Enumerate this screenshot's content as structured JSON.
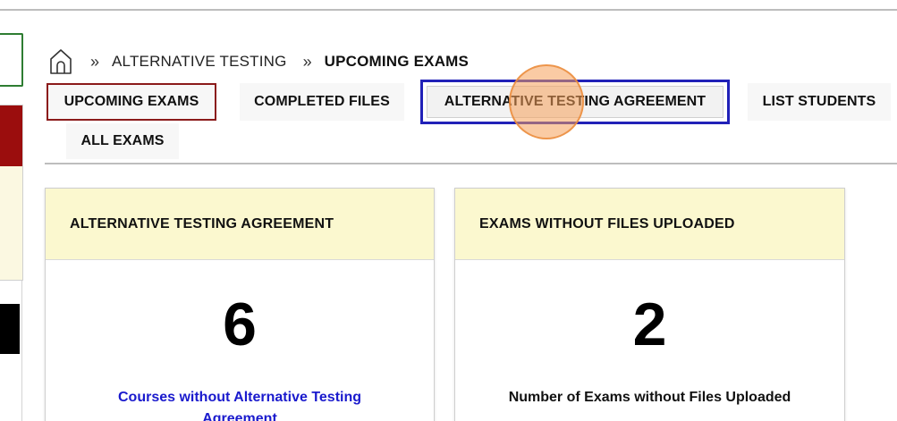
{
  "breadcrumb": {
    "home_icon": "home-icon",
    "separator": "»",
    "items": [
      "ALTERNATIVE TESTING",
      "UPCOMING EXAMS"
    ]
  },
  "tabs": [
    {
      "label": "UPCOMING EXAMS",
      "active": true
    },
    {
      "label": "COMPLETED FILES"
    },
    {
      "label": "ALTERNATIVE TESTING AGREEMENT",
      "highlighted": true
    },
    {
      "label": "LIST STUDENTS"
    },
    {
      "label": "ALL EXAMS"
    }
  ],
  "cards": [
    {
      "title": "ALTERNATIVE TESTING AGREEMENT",
      "count": "6",
      "description": "Courses without Alternative Testing Agreement"
    },
    {
      "title": "EXAMS WITHOUT FILES UPLOADED",
      "count": "2",
      "description": "Number of Exams without Files Uploaded"
    }
  ],
  "colors": {
    "active_tab_border": "#8b1a1a",
    "focus_border": "#2121b8",
    "card_header_bg": "#fbf8cf",
    "link": "#1a1acd",
    "sidebar_green": "#2e7d32",
    "sidebar_red": "#9b0d0d"
  }
}
